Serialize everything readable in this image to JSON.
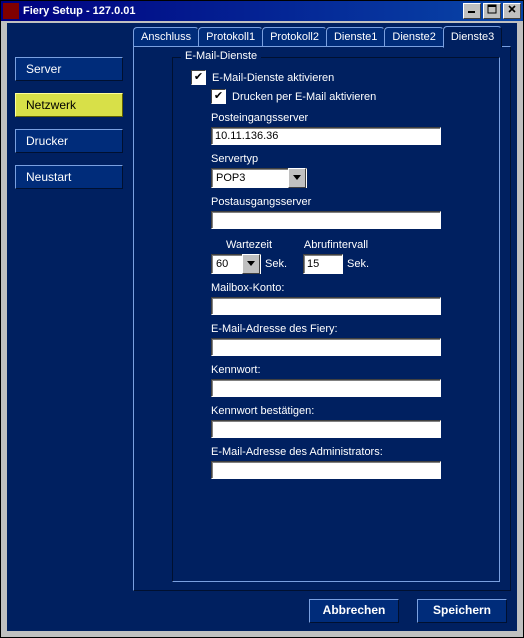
{
  "window": {
    "title": "Fiery Setup  -  127.0.01"
  },
  "sidebar": {
    "items": [
      {
        "label": "Server"
      },
      {
        "label": "Netzwerk"
      },
      {
        "label": "Drucker"
      },
      {
        "label": "Neustart"
      }
    ],
    "active_index": 1
  },
  "tabs": {
    "items": [
      {
        "label": "Anschluss"
      },
      {
        "label": "Protokoll1"
      },
      {
        "label": "Protokoll2"
      },
      {
        "label": "Dienste1"
      },
      {
        "label": "Dienste2"
      },
      {
        "label": "Dienste3"
      }
    ],
    "active_index": 5
  },
  "group": {
    "title": "E-Mail-Dienste",
    "enable_label": "E-Mail-Dienste aktivieren",
    "enable_checked": true,
    "print_label": "Drucken per E-Mail aktivieren",
    "print_checked": true,
    "incoming_label": "Posteingangsserver",
    "incoming_value": "10.11.136.36",
    "servertype_label": "Servertyp",
    "servertype_value": "POP3",
    "outgoing_label": "Postausgangsserver",
    "outgoing_value": "",
    "timeout_label": "Wartezeit",
    "timeout_value": "60",
    "timeout_unit": "Sek.",
    "poll_label": "Abrufintervall",
    "poll_value": "15",
    "poll_unit": "Sek.",
    "mailbox_label": "Mailbox-Konto:",
    "mailbox_value": "",
    "fiery_email_label": "E-Mail-Adresse des Fiery:",
    "fiery_email_value": "",
    "password_label": "Kennwort:",
    "password_value": "",
    "password2_label": "Kennwort bestätigen:",
    "password2_value": "",
    "admin_email_label": "E-Mail-Adresse des Administrators:",
    "admin_email_value": ""
  },
  "buttons": {
    "cancel": "Abbrechen",
    "save": "Speichern"
  }
}
